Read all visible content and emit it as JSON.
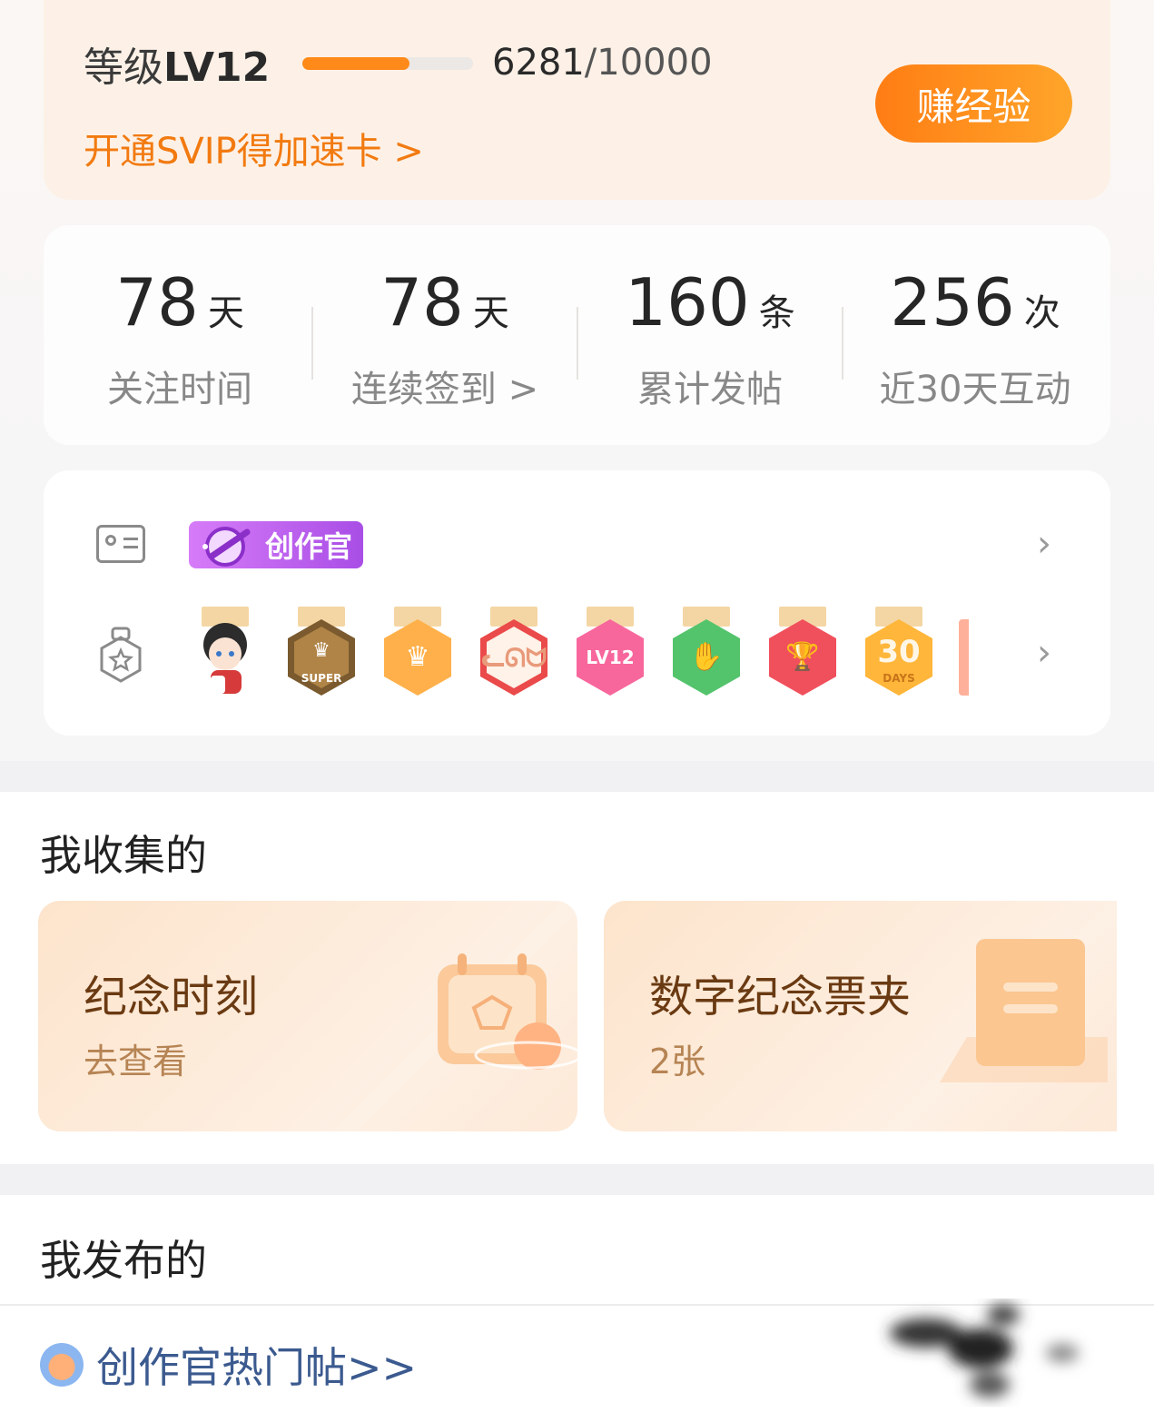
{
  "level": {
    "label": "等级",
    "value": "LV12",
    "progress_current": "6281",
    "progress_total": "/10000",
    "progress_fraction": 0.6281,
    "svip_link": "开通SVIP得加速卡 >",
    "earn_button": "赚经验"
  },
  "stats": [
    {
      "value": "78",
      "unit": "天",
      "label": "关注时间"
    },
    {
      "value": "78",
      "unit": "天",
      "label": "连续签到 >"
    },
    {
      "value": "160",
      "unit": "条",
      "label": "累计发帖"
    },
    {
      "value": "256",
      "unit": "次",
      "label": "近30天互动"
    }
  ],
  "badges": {
    "creator_tag": "创作官",
    "medals": [
      {
        "icon": "character-avatar",
        "text": "",
        "color": "#ffffff"
      },
      {
        "icon": "crown-icon",
        "text": "SUPER",
        "color": "#7a5a2e"
      },
      {
        "icon": "crown-icon",
        "text": "",
        "color": "#ffb04a"
      },
      {
        "icon": "cat-mascot",
        "text": "",
        "color": "#ea4a4a"
      },
      {
        "icon": "level-badge",
        "text": "LV12",
        "color": "#f7679c"
      },
      {
        "icon": "hand-icon",
        "text": "",
        "color": "#54c46c"
      },
      {
        "icon": "trophy-icon",
        "text": "",
        "color": "#f0505c"
      },
      {
        "icon": "days-badge",
        "text": "30",
        "color": "#ffb63a"
      }
    ]
  },
  "collections": {
    "title": "我收集的",
    "cards": [
      {
        "title": "纪念时刻",
        "subtitle": "去查看"
      },
      {
        "title": "数字纪念票夹",
        "subtitle": "2张"
      }
    ]
  },
  "posts": {
    "title": "我发布的",
    "hot_link": "创作官热门帖>>"
  }
}
